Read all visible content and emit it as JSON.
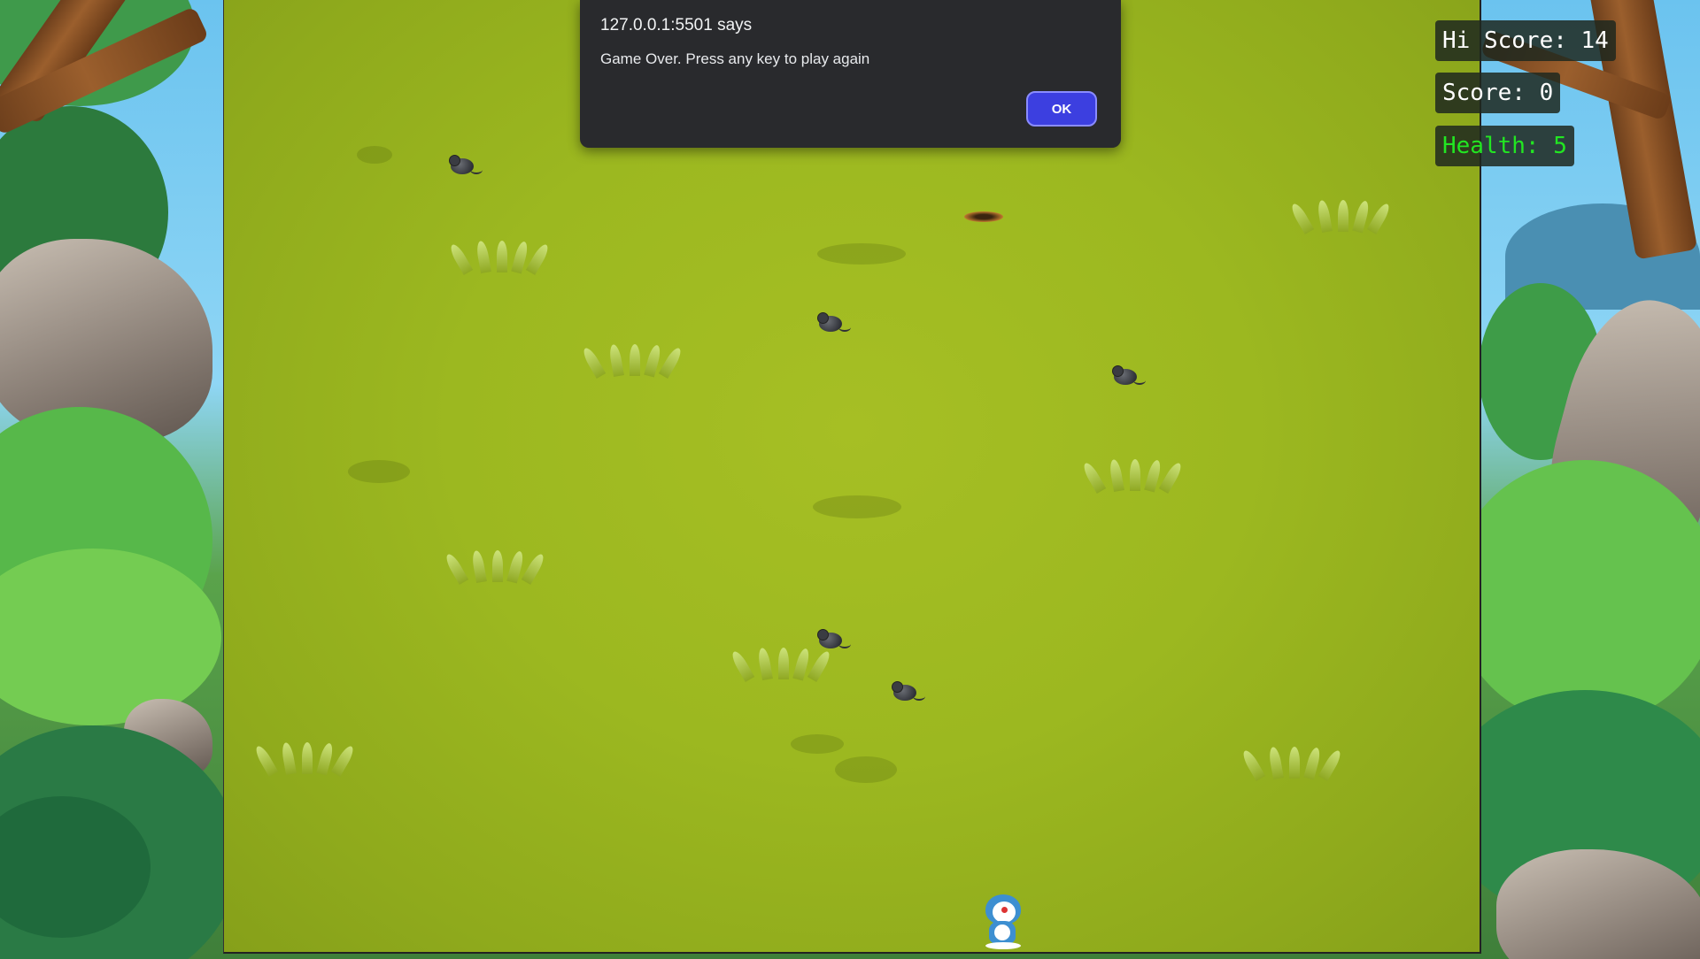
{
  "alert": {
    "origin": "127.0.0.1:5501 says",
    "message": "Game Over. Press any key to play again",
    "ok_label": "OK"
  },
  "hud": {
    "hi_score": "Hi Score: 14",
    "score": "Score: 0",
    "health": "Health: 5",
    "hi_score_color": "#ffffff",
    "score_color": "#ffffff",
    "health_color": "#22e622"
  },
  "game": {
    "enemies": [
      "mouse",
      "mouse",
      "mouse",
      "mouse",
      "mouse"
    ],
    "player": "doraemon-sprite",
    "hole": "mouse-hole"
  },
  "colors": {
    "field": "#9cb820",
    "alert_bg": "#292a2d",
    "ok_button": "#3c3fe0"
  }
}
